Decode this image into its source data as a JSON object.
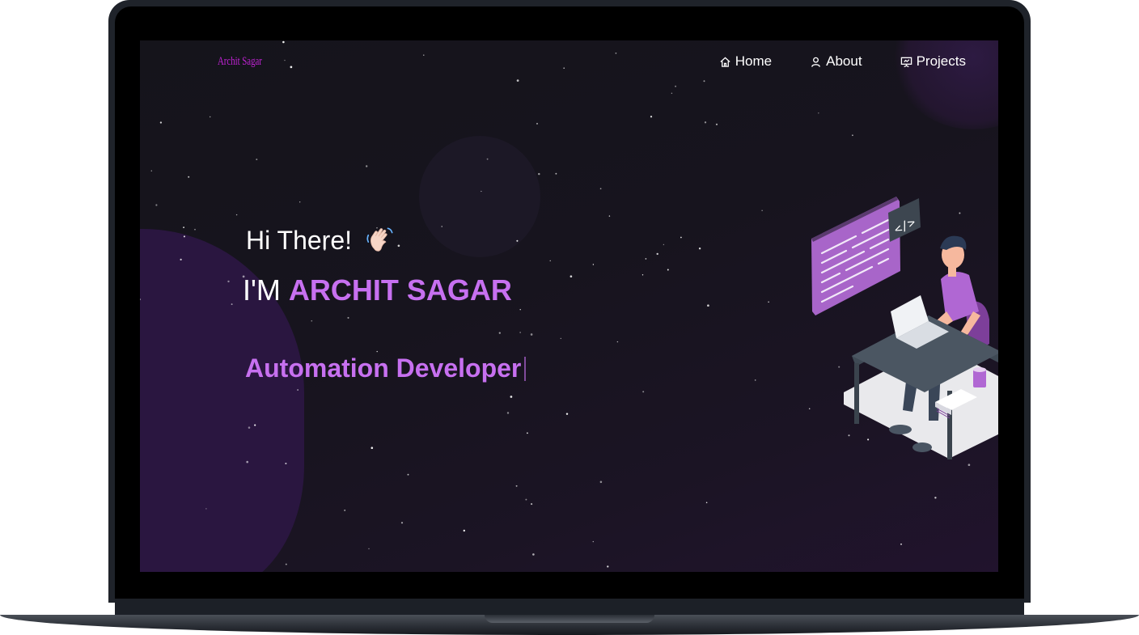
{
  "brand": {
    "logo_text": "Archit Sagar"
  },
  "nav": {
    "items": [
      {
        "label": "Home",
        "icon": "home-icon"
      },
      {
        "label": "About",
        "icon": "user-icon"
      },
      {
        "label": "Projects",
        "icon": "presentation-icon"
      }
    ]
  },
  "hero": {
    "greeting": "Hi There!",
    "greeting_icon": "waving-hand-icon",
    "intro_prefix": "I'M ",
    "name": "ARCHIT SAGAR",
    "role": "Automation Developer",
    "illustration_code_tag": "</>"
  },
  "colors": {
    "accent": "#c770f0",
    "logo": "#c022d4",
    "background": "#16141c",
    "blob": "#2a1640"
  }
}
